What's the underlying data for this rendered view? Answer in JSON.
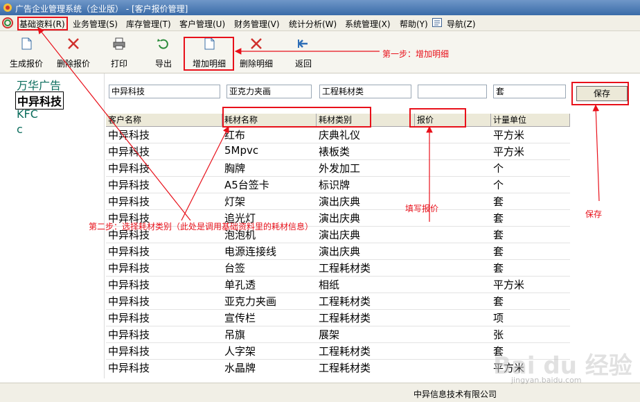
{
  "window": {
    "title": "广告企业管理系统（企业版） - [客户报价管理]"
  },
  "menubar": {
    "items": [
      "基础资料(R)",
      "业务管理(S)",
      "库存管理(T)",
      "客户管理(U)",
      "财务管理(V)",
      "统计分析(W)",
      "系统管理(X)",
      "帮助(Y)",
      "导航(Z)"
    ]
  },
  "toolbar": {
    "buttons": [
      {
        "label": "生成报价",
        "icon": "document-new-icon"
      },
      {
        "label": "删除报价",
        "icon": "delete-x-icon"
      },
      {
        "label": "打印",
        "icon": "printer-icon"
      },
      {
        "label": "导出",
        "icon": "export-arrow-icon"
      },
      {
        "label": "增加明细",
        "icon": "document-add-icon"
      },
      {
        "label": "删除明细",
        "icon": "delete-x-icon"
      },
      {
        "label": "返回",
        "icon": "back-arrow-icon"
      }
    ]
  },
  "customer_list": [
    "万华广告",
    "中异科技",
    "KFC",
    "c"
  ],
  "selected_customer": "中异科技",
  "editor": {
    "customer": "中异科技",
    "material_name": "亚克力夹画",
    "material_type": "工程耗材类",
    "price": "",
    "unit": "套",
    "save_label": "保存"
  },
  "grid": {
    "columns": [
      "客户名称",
      "耗材名称",
      "耗材类别",
      "报价",
      "计量单位"
    ],
    "rows": [
      [
        "中异科技",
        "红布",
        "庆典礼仪",
        "",
        "平方米"
      ],
      [
        "中异科技",
        "5Mpvc",
        "裱板类",
        "",
        "平方米"
      ],
      [
        "中异科技",
        "胸牌",
        "外发加工",
        "",
        "个"
      ],
      [
        "中异科技",
        "A5台签卡",
        "标识牌",
        "",
        "个"
      ],
      [
        "中异科技",
        "灯架",
        "演出庆典",
        "",
        "套"
      ],
      [
        "中异科技",
        "追光灯",
        "演出庆典",
        "",
        "套"
      ],
      [
        "中异科技",
        "泡泡机",
        "演出庆典",
        "",
        "套"
      ],
      [
        "中异科技",
        "电源连接线",
        "演出庆典",
        "",
        "套"
      ],
      [
        "中异科技",
        "台签",
        "工程耗材类",
        "",
        "套"
      ],
      [
        "中异科技",
        "单孔透",
        "相纸",
        "",
        "平方米"
      ],
      [
        "中异科技",
        "亚克力夹画",
        "工程耗材类",
        "",
        "套"
      ],
      [
        "中异科技",
        "宣传栏",
        "工程耗材类",
        "",
        "项"
      ],
      [
        "中异科技",
        "吊旗",
        "展架",
        "",
        "张"
      ],
      [
        "中异科技",
        "人字架",
        "工程耗材类",
        "",
        "套"
      ],
      [
        "中异科技",
        "水晶牌",
        "工程耗材类",
        "",
        "平方米"
      ]
    ]
  },
  "status": {
    "company": "中异信息技术有限公司"
  },
  "annotations": {
    "step1": "第一步：增加明细",
    "step2": "第二步：选择耗材类别（此处是调用基础资料里的耗材信息）",
    "fill_price": "填写报价",
    "save": "保存"
  },
  "watermark": {
    "main": "Bai du 经验",
    "sub": "jingyan.baidu.com"
  },
  "colors": {
    "annotation": "#e8101a",
    "list_text": "#0a6c5c"
  }
}
